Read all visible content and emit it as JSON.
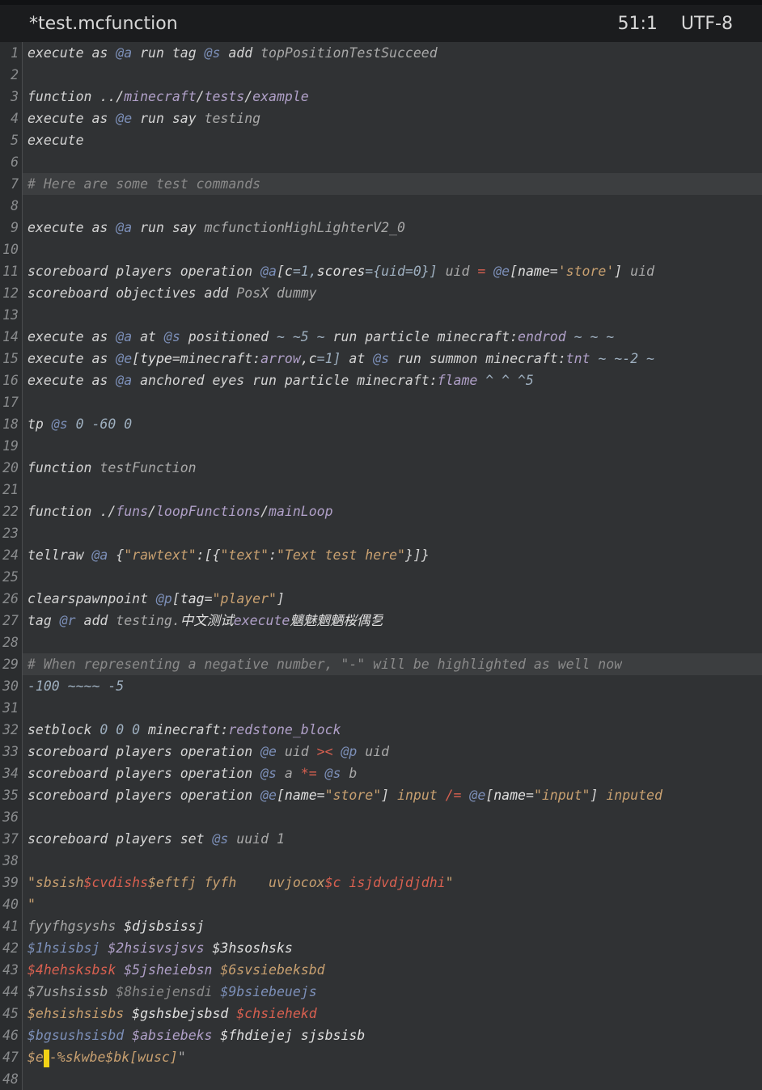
{
  "window": {
    "title": "*test.mcfunction",
    "position": "51:1",
    "encoding": "UTF-8"
  },
  "colors": {
    "cmd": "#d4d4d4",
    "dim": "#a8a8a8",
    "sel": "#7c8fb8",
    "str": "#c8a070",
    "num": "#9fb0c0",
    "op": "#d86050",
    "comment": "#8a8a8a",
    "path": "#b0a0c8",
    "key": "#e0e0e0"
  },
  "lines": [
    {
      "n": "1",
      "hl": false,
      "segs": [
        {
          "t": "execute as ",
          "c": "cmd"
        },
        {
          "t": "@a",
          "c": "sel"
        },
        {
          "t": " run tag ",
          "c": "cmd"
        },
        {
          "t": "@s",
          "c": "sel"
        },
        {
          "t": " add ",
          "c": "cmd"
        },
        {
          "t": "topPositionTestSucceed",
          "c": "dim"
        }
      ]
    },
    {
      "n": "2",
      "hl": false,
      "segs": []
    },
    {
      "n": "3",
      "hl": false,
      "segs": [
        {
          "t": "function ../",
          "c": "cmd"
        },
        {
          "t": "minecraft",
          "c": "path"
        },
        {
          "t": "/",
          "c": "cmd"
        },
        {
          "t": "tests",
          "c": "path"
        },
        {
          "t": "/",
          "c": "cmd"
        },
        {
          "t": "example",
          "c": "path"
        }
      ]
    },
    {
      "n": "4",
      "hl": false,
      "segs": [
        {
          "t": "execute as ",
          "c": "cmd"
        },
        {
          "t": "@e",
          "c": "sel"
        },
        {
          "t": " run say ",
          "c": "cmd"
        },
        {
          "t": "testing",
          "c": "dim"
        }
      ]
    },
    {
      "n": "5",
      "hl": false,
      "segs": [
        {
          "t": "execute",
          "c": "cmd"
        }
      ]
    },
    {
      "n": "6",
      "hl": false,
      "segs": []
    },
    {
      "n": "7",
      "hl": true,
      "segs": [
        {
          "t": "# Here are some test commands",
          "c": "comment"
        }
      ]
    },
    {
      "n": "8",
      "hl": false,
      "segs": []
    },
    {
      "n": "9",
      "hl": false,
      "segs": [
        {
          "t": "execute as ",
          "c": "cmd"
        },
        {
          "t": "@a",
          "c": "sel"
        },
        {
          "t": " run say ",
          "c": "cmd"
        },
        {
          "t": "mcfunctionHighLighterV2_0",
          "c": "dim"
        }
      ]
    },
    {
      "n": "10",
      "hl": false,
      "segs": []
    },
    {
      "n": "11",
      "hl": false,
      "segs": [
        {
          "t": "scoreboard players operation ",
          "c": "cmd"
        },
        {
          "t": "@a",
          "c": "sel"
        },
        {
          "t": "[",
          "c": "cmd"
        },
        {
          "t": "c",
          "c": "key"
        },
        {
          "t": "=1,",
          "c": "num"
        },
        {
          "t": "scores",
          "c": "key"
        },
        {
          "t": "={uid=0}] ",
          "c": "num"
        },
        {
          "t": "uid",
          "c": "dim"
        },
        {
          "t": " = ",
          "c": "op"
        },
        {
          "t": "@e",
          "c": "sel"
        },
        {
          "t": "[",
          "c": "cmd"
        },
        {
          "t": "name",
          "c": "key"
        },
        {
          "t": "=",
          "c": "cmd"
        },
        {
          "t": "'store'",
          "c": "str"
        },
        {
          "t": "] ",
          "c": "cmd"
        },
        {
          "t": "uid",
          "c": "dim"
        }
      ]
    },
    {
      "n": "12",
      "hl": false,
      "segs": [
        {
          "t": "scoreboard objectives add ",
          "c": "cmd"
        },
        {
          "t": "PosX dummy",
          "c": "dim"
        }
      ]
    },
    {
      "n": "13",
      "hl": false,
      "segs": []
    },
    {
      "n": "14",
      "hl": false,
      "segs": [
        {
          "t": "execute as ",
          "c": "cmd"
        },
        {
          "t": "@a",
          "c": "sel"
        },
        {
          "t": " at ",
          "c": "cmd"
        },
        {
          "t": "@s",
          "c": "sel"
        },
        {
          "t": " positioned ",
          "c": "cmd"
        },
        {
          "t": "~ ~5 ~",
          "c": "num"
        },
        {
          "t": " run particle minecraft:",
          "c": "cmd"
        },
        {
          "t": "endrod",
          "c": "path"
        },
        {
          "t": " ~ ~ ~",
          "c": "num"
        }
      ]
    },
    {
      "n": "15",
      "hl": false,
      "segs": [
        {
          "t": "execute as ",
          "c": "cmd"
        },
        {
          "t": "@e",
          "c": "sel"
        },
        {
          "t": "[",
          "c": "cmd"
        },
        {
          "t": "type",
          "c": "key"
        },
        {
          "t": "=minecraft:",
          "c": "cmd"
        },
        {
          "t": "arrow",
          "c": "path"
        },
        {
          "t": ",c",
          "c": "key"
        },
        {
          "t": "=1] ",
          "c": "num"
        },
        {
          "t": "at ",
          "c": "cmd"
        },
        {
          "t": "@s",
          "c": "sel"
        },
        {
          "t": " run summon minecraft:",
          "c": "cmd"
        },
        {
          "t": "tnt",
          "c": "path"
        },
        {
          "t": " ~ ~-2 ~",
          "c": "num"
        }
      ]
    },
    {
      "n": "16",
      "hl": false,
      "segs": [
        {
          "t": "execute as ",
          "c": "cmd"
        },
        {
          "t": "@a",
          "c": "sel"
        },
        {
          "t": " anchored eyes run particle minecraft:",
          "c": "cmd"
        },
        {
          "t": "flame",
          "c": "path"
        },
        {
          "t": " ^ ^ ^5",
          "c": "num"
        }
      ]
    },
    {
      "n": "17",
      "hl": false,
      "segs": []
    },
    {
      "n": "18",
      "hl": false,
      "segs": [
        {
          "t": "tp ",
          "c": "cmd"
        },
        {
          "t": "@s",
          "c": "sel"
        },
        {
          "t": " 0 -60 0",
          "c": "num"
        }
      ]
    },
    {
      "n": "19",
      "hl": false,
      "segs": []
    },
    {
      "n": "20",
      "hl": false,
      "segs": [
        {
          "t": "function ",
          "c": "cmd"
        },
        {
          "t": "testFunction",
          "c": "dim"
        }
      ]
    },
    {
      "n": "21",
      "hl": false,
      "segs": []
    },
    {
      "n": "22",
      "hl": false,
      "segs": [
        {
          "t": "function ./",
          "c": "cmd"
        },
        {
          "t": "funs",
          "c": "path"
        },
        {
          "t": "/",
          "c": "cmd"
        },
        {
          "t": "loopFunctions",
          "c": "path"
        },
        {
          "t": "/",
          "c": "cmd"
        },
        {
          "t": "mainLoop",
          "c": "path"
        }
      ]
    },
    {
      "n": "23",
      "hl": false,
      "segs": []
    },
    {
      "n": "24",
      "hl": false,
      "segs": [
        {
          "t": "tellraw ",
          "c": "cmd"
        },
        {
          "t": "@a",
          "c": "sel"
        },
        {
          "t": " {",
          "c": "cmd"
        },
        {
          "t": "\"rawtext\"",
          "c": "str"
        },
        {
          "t": ":[{",
          "c": "cmd"
        },
        {
          "t": "\"text\"",
          "c": "str"
        },
        {
          "t": ":",
          "c": "cmd"
        },
        {
          "t": "\"Text test here\"",
          "c": "str"
        },
        {
          "t": "}]}",
          "c": "cmd"
        }
      ]
    },
    {
      "n": "25",
      "hl": false,
      "segs": []
    },
    {
      "n": "26",
      "hl": false,
      "segs": [
        {
          "t": "clearspawnpoint ",
          "c": "cmd"
        },
        {
          "t": "@p",
          "c": "sel"
        },
        {
          "t": "[",
          "c": "cmd"
        },
        {
          "t": "tag",
          "c": "key"
        },
        {
          "t": "=",
          "c": "cmd"
        },
        {
          "t": "\"player\"",
          "c": "str"
        },
        {
          "t": "]",
          "c": "cmd"
        }
      ]
    },
    {
      "n": "27",
      "hl": false,
      "segs": [
        {
          "t": "tag ",
          "c": "cmd"
        },
        {
          "t": "@r",
          "c": "sel"
        },
        {
          "t": " add ",
          "c": "cmd"
        },
        {
          "t": "testing.",
          "c": "dim"
        },
        {
          "t": "中文测试",
          "c": "key"
        },
        {
          "t": "execute",
          "c": "path"
        },
        {
          "t": "魑魅魍魉桜偶乭",
          "c": "key"
        }
      ]
    },
    {
      "n": "28",
      "hl": false,
      "segs": []
    },
    {
      "n": "29",
      "hl": true,
      "segs": [
        {
          "t": "# When representing a negative number, \"-\" will be highlighted as well now",
          "c": "comment"
        }
      ]
    },
    {
      "n": "30",
      "hl": false,
      "segs": [
        {
          "t": "-100 ~~~~ -5",
          "c": "num"
        }
      ]
    },
    {
      "n": "31",
      "hl": false,
      "segs": []
    },
    {
      "n": "32",
      "hl": false,
      "segs": [
        {
          "t": "setblock ",
          "c": "cmd"
        },
        {
          "t": "0 0 0",
          "c": "num"
        },
        {
          "t": " minecraft:",
          "c": "cmd"
        },
        {
          "t": "redstone_block",
          "c": "path"
        }
      ]
    },
    {
      "n": "33",
      "hl": false,
      "segs": [
        {
          "t": "scoreboard players operation ",
          "c": "cmd"
        },
        {
          "t": "@e",
          "c": "sel"
        },
        {
          "t": " uid ",
          "c": "dim"
        },
        {
          "t": "><",
          "c": "op"
        },
        {
          "t": " @p",
          "c": "sel"
        },
        {
          "t": " uid",
          "c": "dim"
        }
      ]
    },
    {
      "n": "34",
      "hl": false,
      "segs": [
        {
          "t": "scoreboard players operation ",
          "c": "cmd"
        },
        {
          "t": "@s",
          "c": "sel"
        },
        {
          "t": " a ",
          "c": "dim"
        },
        {
          "t": "*=",
          "c": "op"
        },
        {
          "t": " @s",
          "c": "sel"
        },
        {
          "t": " b",
          "c": "dim"
        }
      ]
    },
    {
      "n": "35",
      "hl": false,
      "segs": [
        {
          "t": "scoreboard players operation ",
          "c": "cmd"
        },
        {
          "t": "@e",
          "c": "sel"
        },
        {
          "t": "[",
          "c": "cmd"
        },
        {
          "t": "name",
          "c": "key"
        },
        {
          "t": "=",
          "c": "cmd"
        },
        {
          "t": "\"store\"",
          "c": "str"
        },
        {
          "t": "] ",
          "c": "cmd"
        },
        {
          "t": "input ",
          "c": "str"
        },
        {
          "t": "/=",
          "c": "op"
        },
        {
          "t": " @e",
          "c": "sel"
        },
        {
          "t": "[",
          "c": "cmd"
        },
        {
          "t": "name",
          "c": "key"
        },
        {
          "t": "=",
          "c": "cmd"
        },
        {
          "t": "\"input\"",
          "c": "str"
        },
        {
          "t": "] ",
          "c": "cmd"
        },
        {
          "t": "inputed",
          "c": "str"
        }
      ]
    },
    {
      "n": "36",
      "hl": false,
      "segs": []
    },
    {
      "n": "37",
      "hl": false,
      "segs": [
        {
          "t": "scoreboard players set ",
          "c": "cmd"
        },
        {
          "t": "@s",
          "c": "sel"
        },
        {
          "t": " uuid 1",
          "c": "dim"
        }
      ]
    },
    {
      "n": "38",
      "hl": false,
      "segs": []
    },
    {
      "n": "39",
      "hl": false,
      "segs": [
        {
          "t": "\"sbsish",
          "c": "str"
        },
        {
          "t": "$cvdishs",
          "c": "op"
        },
        {
          "t": "$eftfj fyfh    uvjocox",
          "c": "str"
        },
        {
          "t": "$c isjdvdjdjdhi",
          "c": "op"
        },
        {
          "t": "\"",
          "c": "str"
        }
      ]
    },
    {
      "n": "40",
      "hl": false,
      "segs": [
        {
          "t": "\"",
          "c": "str"
        }
      ]
    },
    {
      "n": "41",
      "hl": false,
      "segs": [
        {
          "t": "fyyfhgsyshs ",
          "c": "dim"
        },
        {
          "t": "$djsbsissj",
          "c": "key"
        }
      ]
    },
    {
      "n": "42",
      "hl": false,
      "segs": [
        {
          "t": "$1hsisbsj",
          "c": "sel"
        },
        {
          "t": " $2hsisvsjsvs",
          "c": "path"
        },
        {
          "t": " $3hsoshsks",
          "c": "key"
        }
      ]
    },
    {
      "n": "43",
      "hl": false,
      "segs": [
        {
          "t": "$4hehsksbsk",
          "c": "op"
        },
        {
          "t": " $5jsheiebsn",
          "c": "path"
        },
        {
          "t": " $6svsiebeksbd",
          "c": "str"
        }
      ]
    },
    {
      "n": "44",
      "hl": false,
      "segs": [
        {
          "t": "$7ushsissb ",
          "c": "dim"
        },
        {
          "t": "$8hsiejensdi",
          "c": "comment"
        },
        {
          "t": " $9bsiebeuejs",
          "c": "sel"
        }
      ]
    },
    {
      "n": "45",
      "hl": false,
      "segs": [
        {
          "t": "$ehsishsisbs",
          "c": "str"
        },
        {
          "t": " $gshsbejsbsd",
          "c": "key"
        },
        {
          "t": " $chsiehekd",
          "c": "op"
        }
      ]
    },
    {
      "n": "46",
      "hl": false,
      "segs": [
        {
          "t": "$bgsushsisbd",
          "c": "sel"
        },
        {
          "t": " $absiebeks",
          "c": "path"
        },
        {
          "t": " $fhdiejej sjsbsisb",
          "c": "key"
        }
      ]
    },
    {
      "n": "47",
      "hl": false,
      "cursor": true,
      "segs": [
        {
          "t": "$e",
          "c": "str"
        },
        {
          "t": "CURSOR",
          "c": "cursor"
        },
        {
          "t": "-%skwbe$bk[wusc]",
          "c": "str"
        },
        {
          "t": "\"",
          "c": "dim"
        }
      ]
    },
    {
      "n": "48",
      "hl": false,
      "segs": []
    }
  ]
}
